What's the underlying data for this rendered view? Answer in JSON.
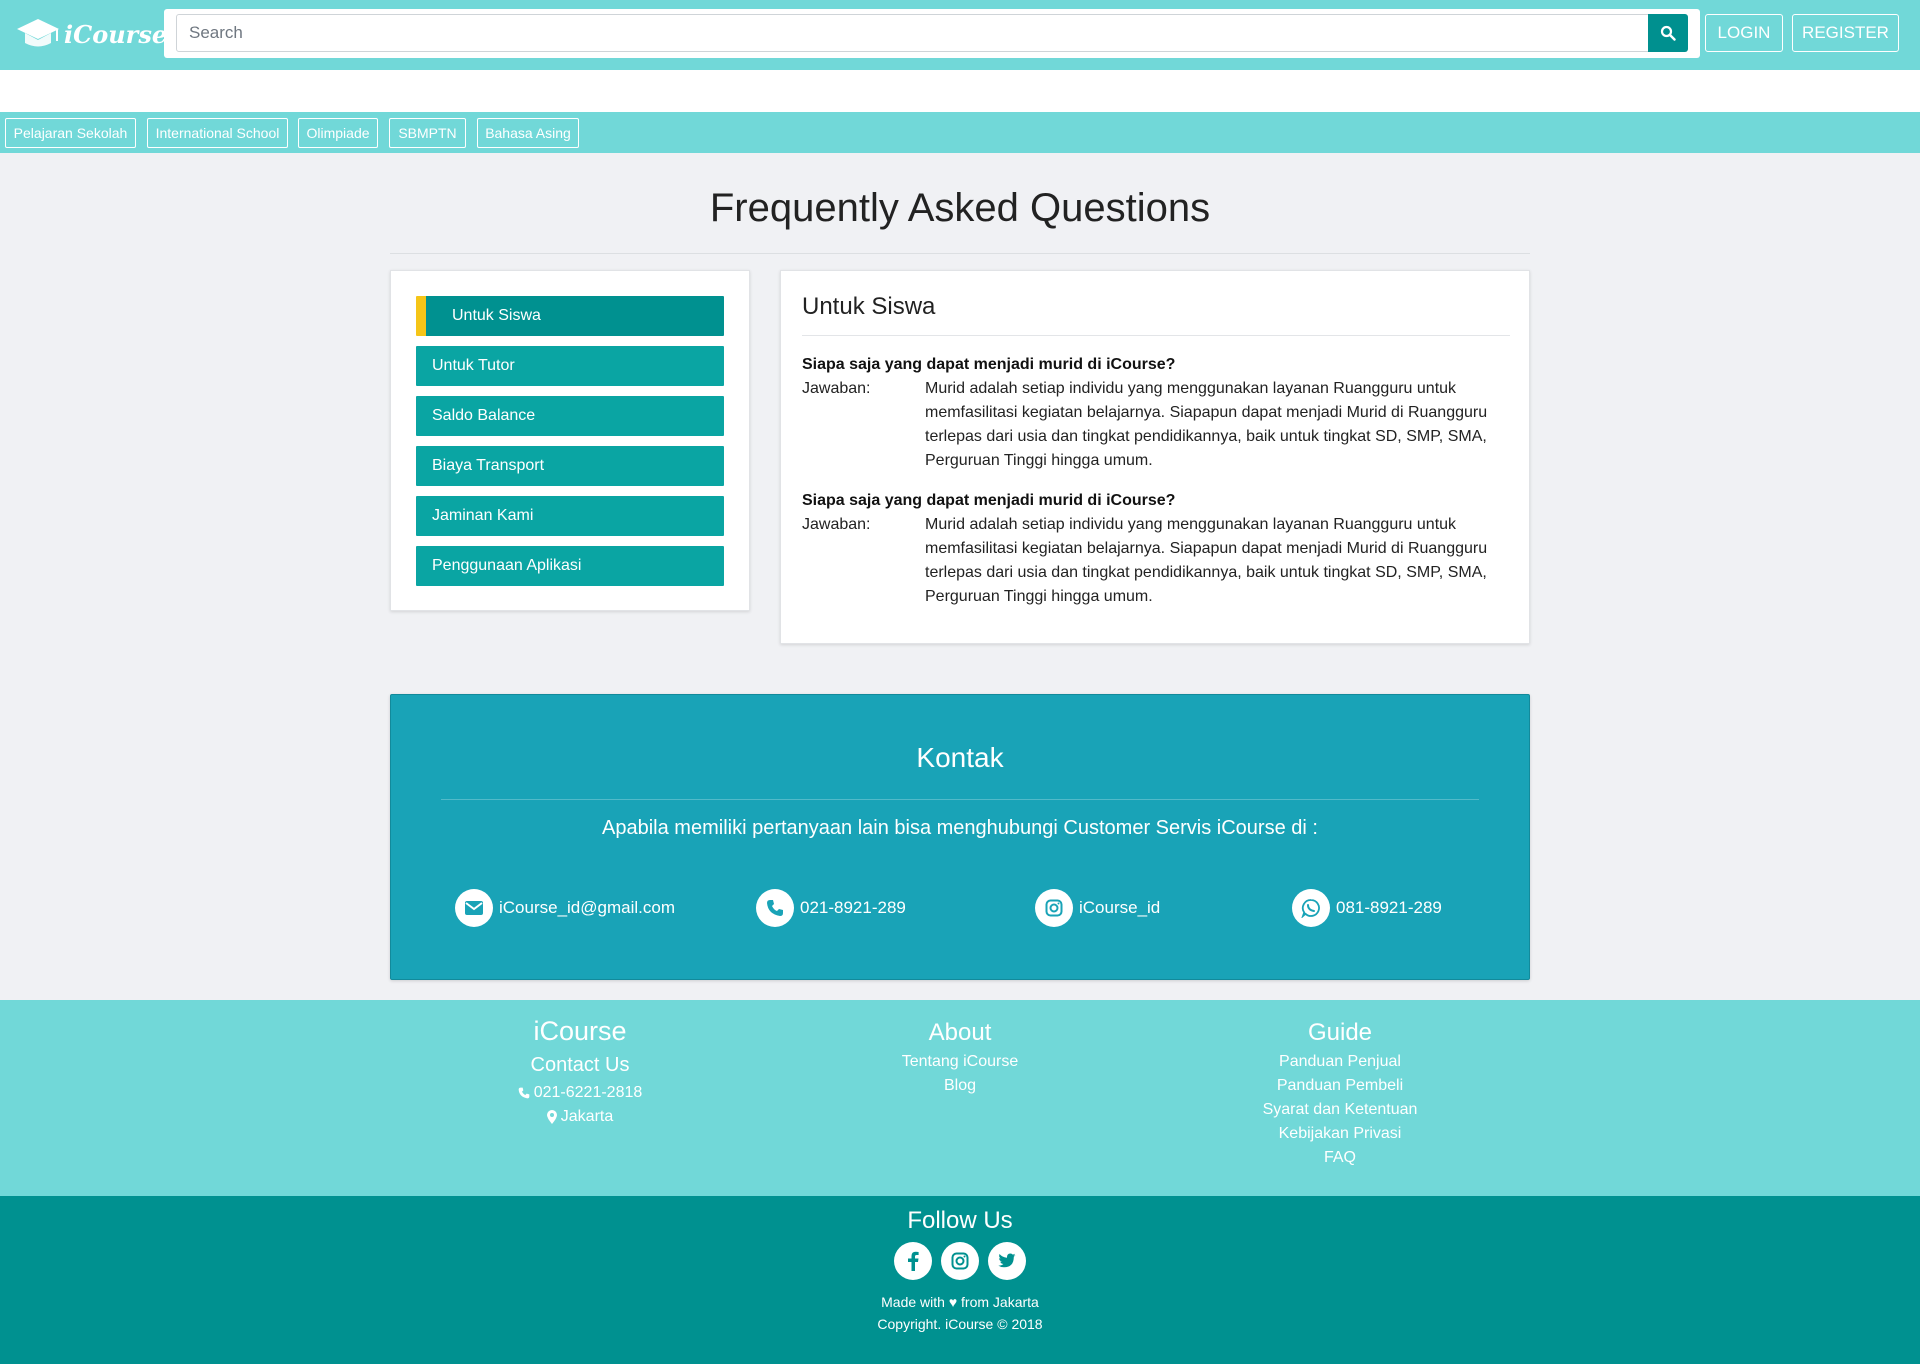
{
  "header": {
    "logo_text": "iCourse",
    "search_placeholder": "Search",
    "login_label": "LOGIN",
    "register_label": "REGISTER"
  },
  "categories": [
    "Pelajaran Sekolah",
    "International School",
    "Olimpiade",
    "SBMPTN",
    "Bahasa Asing"
  ],
  "faq": {
    "title": "Frequently Asked Questions",
    "menu": [
      "Untuk Siswa",
      "Untuk Tutor",
      "Saldo Balance",
      "Biaya Transport",
      "Jaminan Kami",
      "Penggunaan Aplikasi"
    ],
    "active_section": "Untuk Siswa",
    "items": [
      {
        "question": "Siapa saja yang dapat menjadi murid di iCourse?",
        "answer_label": "Jawaban:",
        "answer": "Murid adalah setiap individu yang menggunakan layanan Ruangguru untuk memfasilitasi kegiatan belajarnya. Siapapun dapat menjadi Murid di Ruangguru terlepas dari usia dan tingkat pendidikannya, baik untuk tingkat SD, SMP, SMA, Perguruan Tinggi hingga umum."
      },
      {
        "question": "Siapa saja yang dapat menjadi murid di iCourse?",
        "answer_label": "Jawaban:",
        "answer": "Murid adalah setiap individu yang menggunakan layanan Ruangguru untuk memfasilitasi kegiatan belajarnya. Siapapun dapat menjadi Murid di Ruangguru terlepas dari usia dan tingkat pendidikannya, baik untuk tingkat SD, SMP, SMA, Perguruan Tinggi hingga umum."
      }
    ]
  },
  "kontak": {
    "title": "Kontak",
    "description": "Apabila memiliki pertanyaan lain bisa menghubungi Customer Servis iCourse di :",
    "email": "iCourse_id@gmail.com",
    "phone": "021-8921-289",
    "instagram": "iCourse_id",
    "whatsapp": "081-8921-289"
  },
  "footer": {
    "brand": "iCourse",
    "contact_title": "Contact Us",
    "contact_phone": "021-6221-2818",
    "contact_city": "Jakarta",
    "about_title": "About",
    "about_links": [
      "Tentang iCourse",
      "Blog"
    ],
    "guide_title": "Guide",
    "guide_links": [
      "Panduan Penjual",
      "Panduan Pembeli",
      "Syarat dan Ketentuan",
      "Kebijakan Privasi",
      "FAQ"
    ],
    "follow_title": "Follow Us",
    "made_with": "Made with ♥ from Jakarta",
    "copyright": "Copyright. iCourse © 2018"
  },
  "colors": {
    "teal_light": "#71d8d8",
    "teal_dark": "#009190",
    "teal_button": "#0aa5a3",
    "kontak_bg": "#19a3b7",
    "accent_yellow": "#f5c518"
  }
}
